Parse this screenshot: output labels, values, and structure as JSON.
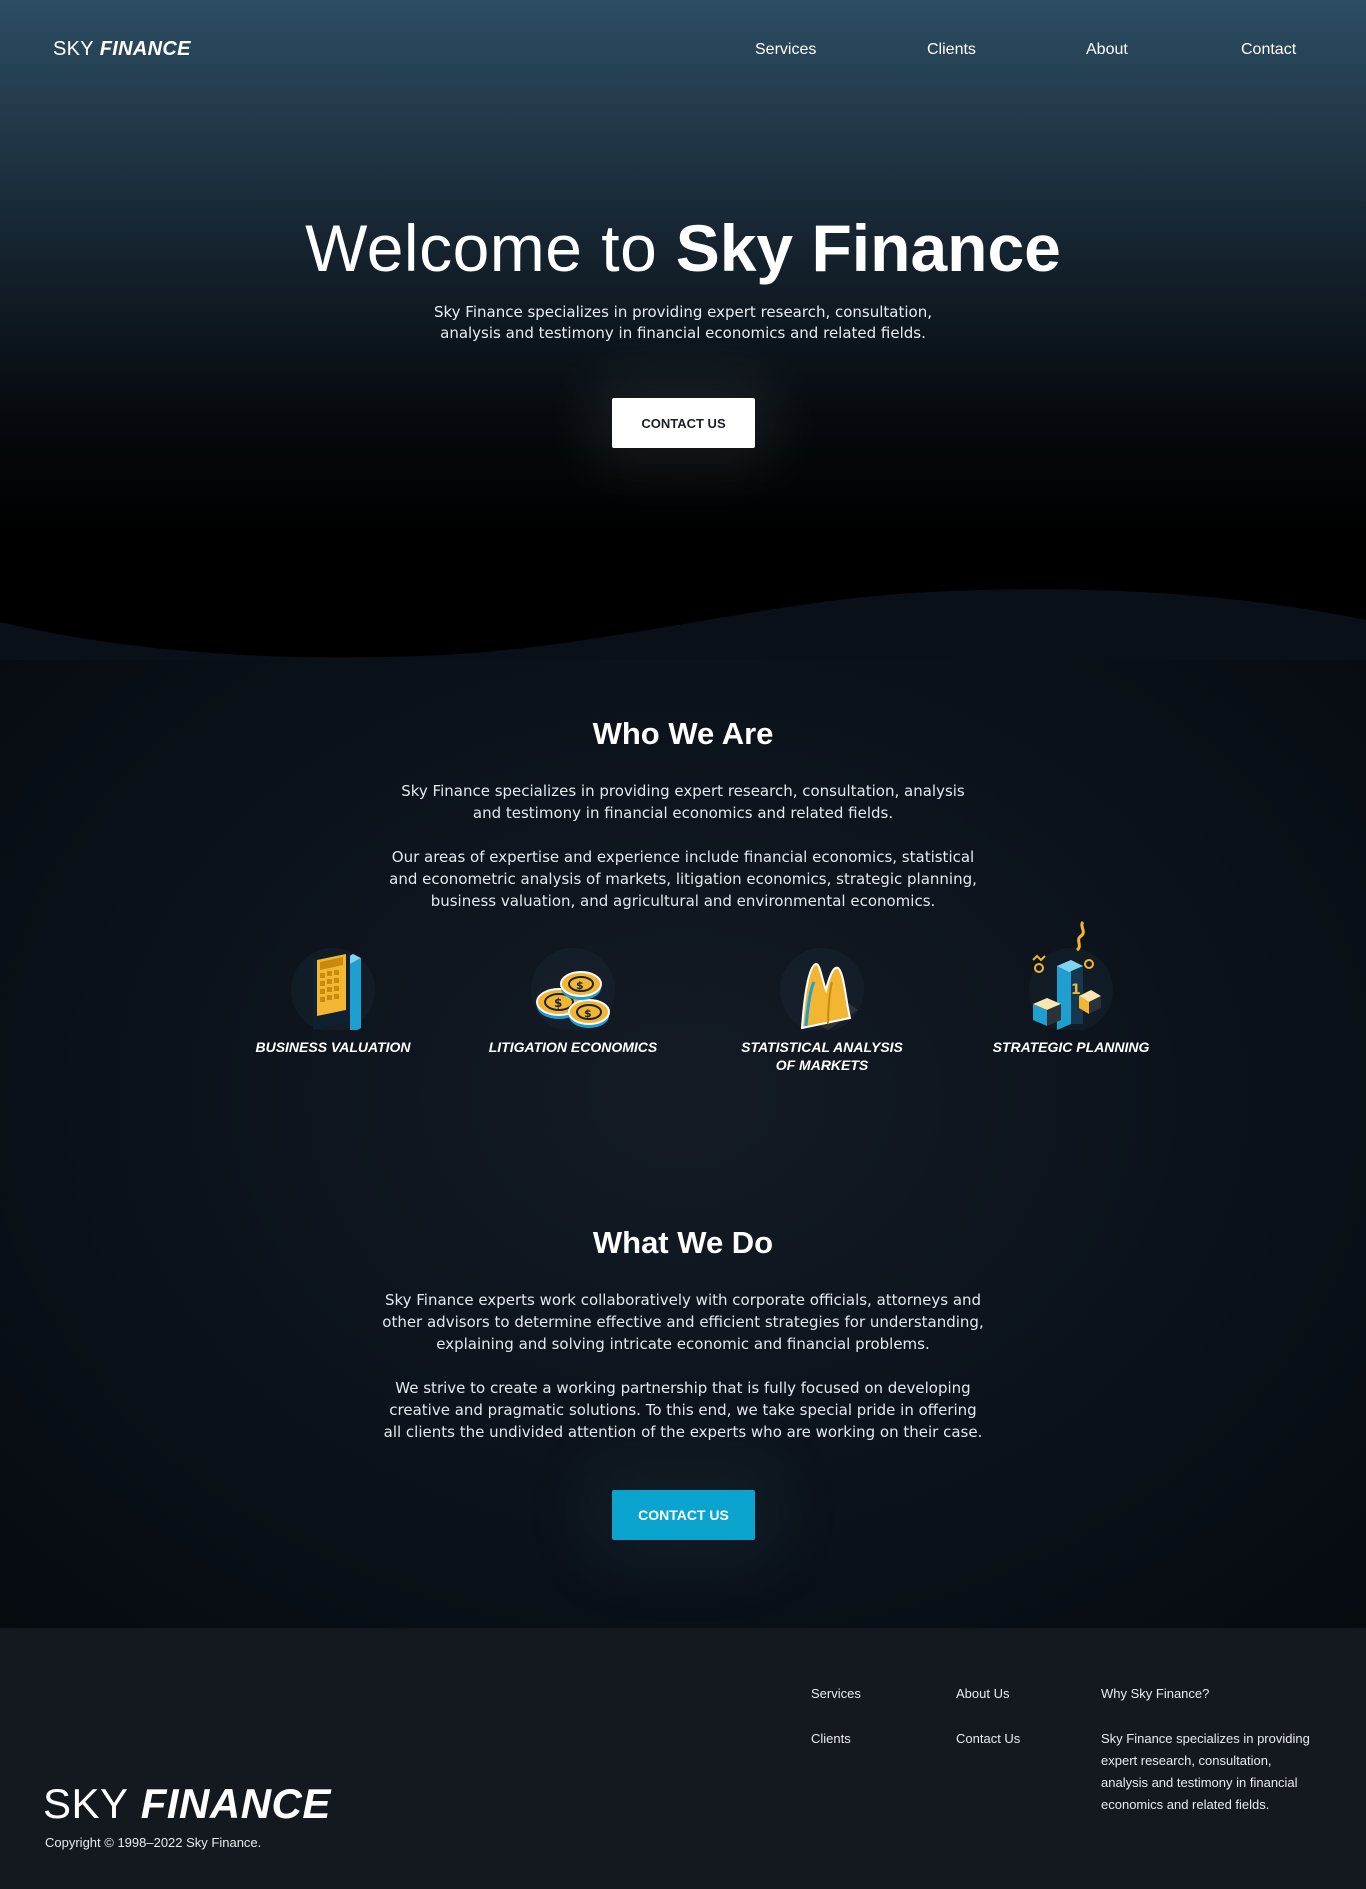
{
  "brand": {
    "light": "SKY",
    "bold": "FINANCE"
  },
  "nav": {
    "items": [
      "Services",
      "Clients",
      "About",
      "Contact"
    ]
  },
  "hero": {
    "title_light": "Welcome to",
    "title_bold": "Sky Finance",
    "subtitle": "Sky Finance specializes in providing expert research, consultation, analysis and testimony in financial economics and related fields.",
    "cta_label": "CONTACT US"
  },
  "who": {
    "title": "Who We Are",
    "para1": "Sky Finance specializes in providing expert research, consultation, analysis and testimony in financial economics and related fields.",
    "para2": "Our areas of expertise and experience include financial economics, statistical and econometric analysis of markets, litigation economics, strategic planning, business valuation, and agricultural and environmental economics."
  },
  "features": [
    {
      "label": "BUSINESS VALUATION",
      "icon": "calculator-icon"
    },
    {
      "label": "LITIGATION ECONOMICS",
      "icon": "coins-icon"
    },
    {
      "label": "STATISTICAL ANALYSIS OF MARKETS",
      "icon": "chart-peaks-icon"
    },
    {
      "label": "STRATEGIC PLANNING",
      "icon": "podium-icon"
    }
  ],
  "what": {
    "title": "What We Do",
    "para1": "Sky Finance experts work collaboratively with corporate officials, attorneys and other advisors to determine effective and efficient strategies for understanding, explaining and solving intricate economic and financial problems.",
    "para2": "We strive to create a working partnership that is fully focused on developing creative and pragmatic solutions. To this end, we take special pride in offering all clients the undivided attention of the experts who are working on their case.",
    "cta_label": "CONTACT US"
  },
  "footer": {
    "links_col1": [
      "Services",
      "Clients"
    ],
    "links_col2": [
      "About Us",
      "Contact Us"
    ],
    "why_title": "Why Sky Finance?",
    "why_text": "Sky Finance specializes in providing expert research, consultation, analysis and testimony in financial economics and related fields.",
    "copyright": "Copyright © 1998–2022 Sky Finance."
  },
  "colors": {
    "accent_blue": "#0aa4cf",
    "icon_yellow": "#f2b632",
    "icon_blue": "#1f9ed0",
    "footer_bg": "#141920"
  }
}
